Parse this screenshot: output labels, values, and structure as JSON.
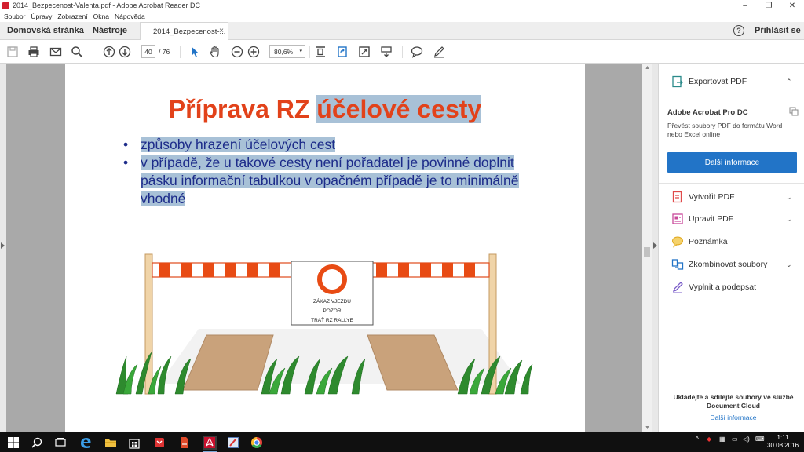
{
  "window": {
    "title": "2014_Bezpecenost-Valenta.pdf - Adobe Acrobat Reader DC",
    "minimize": "–",
    "maximize": "❐",
    "close": "✕"
  },
  "menu": [
    "Soubor",
    "Úpravy",
    "Zobrazení",
    "Okna",
    "Nápověda"
  ],
  "tabs": {
    "home": "Domovská stránka",
    "tools": "Nástroje",
    "document": "2014_Bezpecenost-...",
    "close": "×",
    "help": "?",
    "login": "Přihlásit se"
  },
  "toolbar": {
    "page_current": "40",
    "page_total": "/ 76",
    "zoom": "80,6%",
    "zoom_dropdown": "▾"
  },
  "slide": {
    "title_plain": "Příprava RZ ",
    "title_highlight": "účelové cesty",
    "bullet_symbol": "•",
    "bullets": [
      {
        "text": "způsoby hrazení účelových cest"
      },
      {
        "text": "v případě, že u takové cesty není pořadatel je povinné doplnit pásku informační tabulkou v opačném případě je to minimálně vhodné"
      }
    ],
    "sign_lines": [
      "ZÁKAZ VJEZDU",
      "POZOR",
      "TRAŤ RZ RALLYE"
    ]
  },
  "sidebar": {
    "export": "Exportovat PDF",
    "pro_title": "Adobe Acrobat Pro DC",
    "pro_desc": "Převést soubory PDF do formátu Word nebo Excel online",
    "button": "Další informace",
    "items": [
      {
        "label": "Vytvořit PDF",
        "chevron": "⌄"
      },
      {
        "label": "Upravit PDF",
        "chevron": "⌄"
      },
      {
        "label": "Poznámka",
        "chevron": ""
      },
      {
        "label": "Zkombinovat soubory",
        "chevron": "⌄"
      },
      {
        "label": "Vyplnit a podepsat",
        "chevron": ""
      }
    ],
    "export_chevron": "⌃",
    "footer": "Ukládejte a sdílejte soubory ve službě Document Cloud",
    "footer_link": "Další informace"
  },
  "taskbar": {
    "time": "1:11",
    "date": "30.08.2016"
  },
  "colors": {
    "accent_blue": "#2274c7",
    "title_red": "#e2421a",
    "bullet_blue": "#1d2c8a",
    "highlight": "#a8c1d7"
  }
}
